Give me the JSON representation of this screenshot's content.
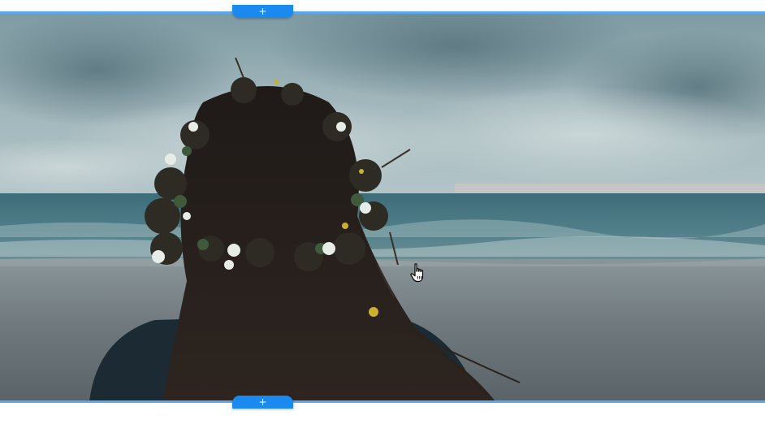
{
  "editor": {
    "add_section_top_label": "+",
    "add_section_bottom_label": "+",
    "accent_color": "#1b8af0",
    "section_outline_color": "#59a8ec"
  },
  "image": {
    "icon": "photo-icon"
  },
  "cursor": {
    "icon": "hand-pointer-icon"
  }
}
